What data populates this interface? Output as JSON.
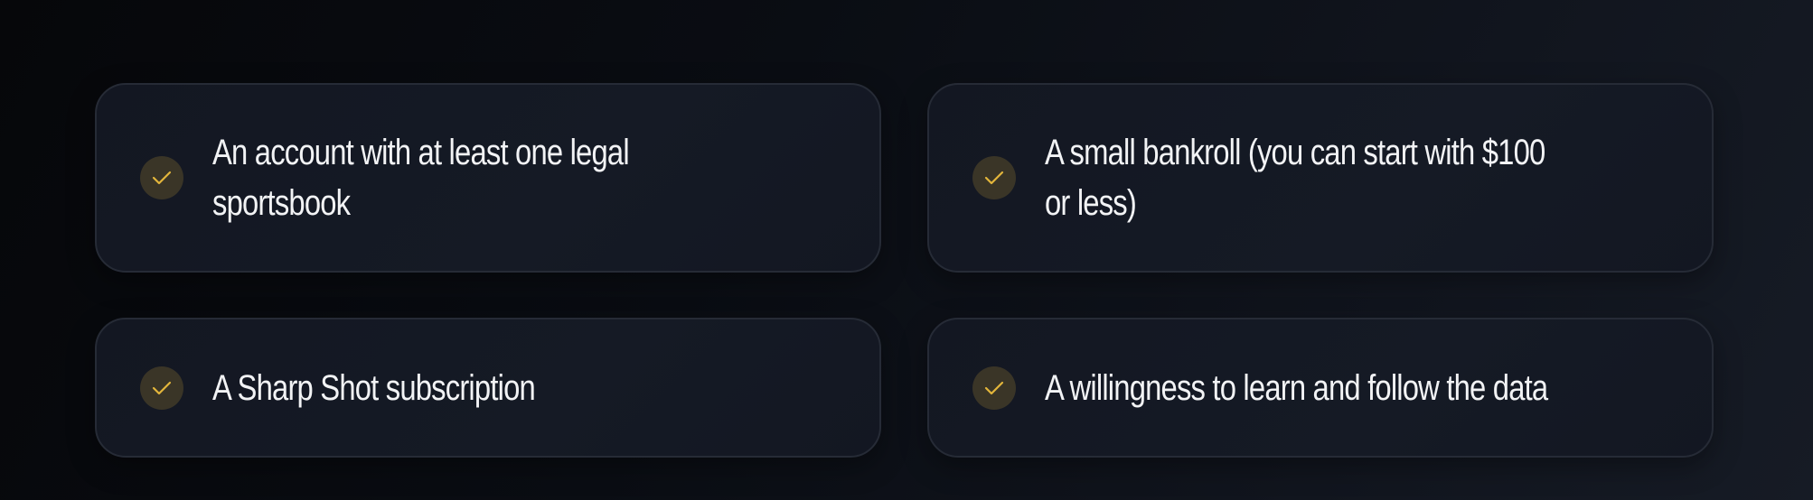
{
  "requirements": {
    "items": [
      {
        "text": "An account with at least one legal sportsbook",
        "icon": "check-icon"
      },
      {
        "text": "A small bankroll (you can start with $100 or less)",
        "icon": "check-icon"
      },
      {
        "text": "A Sharp Shot subscription",
        "icon": "check-icon"
      },
      {
        "text": "A willingness to learn and follow the data",
        "icon": "check-icon"
      }
    ]
  },
  "colors": {
    "accent": "#e2b53b",
    "check_bg": "#3a3527",
    "card_bg": "#141823",
    "card_border": "#262b36",
    "text": "#f2f3f5"
  }
}
